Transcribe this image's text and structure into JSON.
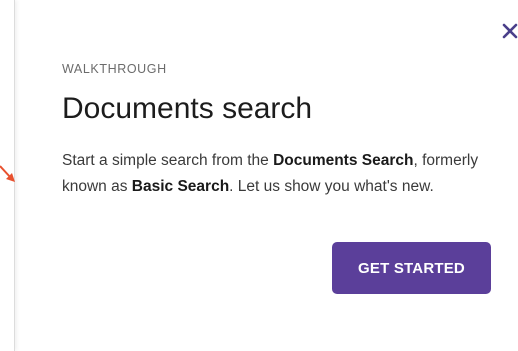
{
  "walkthrough": {
    "eyebrow": "WALKTHROUGH",
    "title": "Documents search",
    "body": {
      "intro": "Start a simple search from the ",
      "documents_search": "Documents Search",
      "mid": ", formerly known as ",
      "basic_search": "Basic Search",
      "outro": ".  Let us show you what's new."
    },
    "cta_label": "GET STARTED",
    "close_icon": "close-icon"
  },
  "colors": {
    "accent": "#5b3f9a",
    "close_icon": "#4a3f8a",
    "pointer": "#e8512f"
  }
}
